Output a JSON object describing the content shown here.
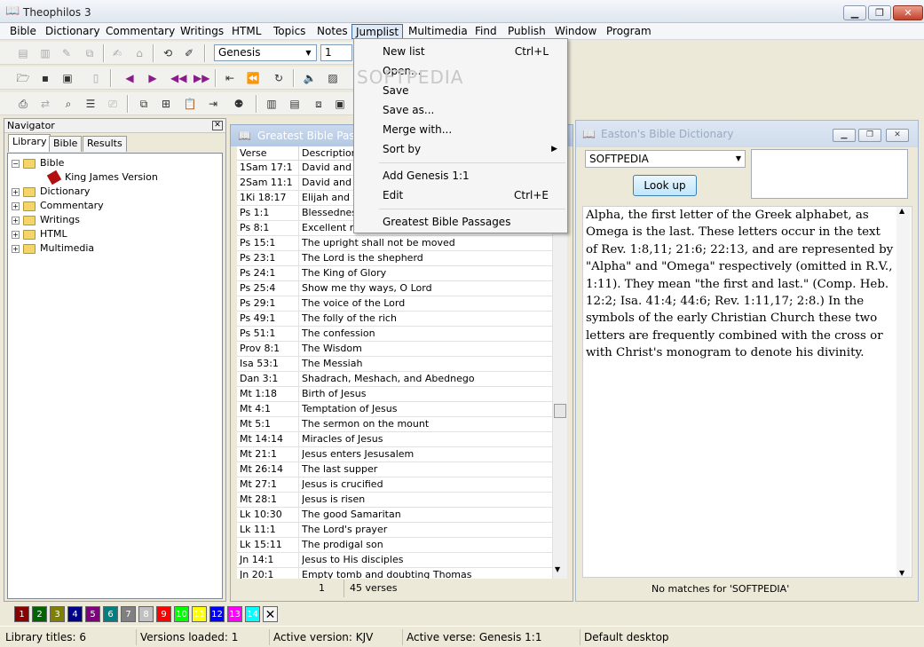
{
  "window": {
    "title": "Theophilos 3"
  },
  "menubar": [
    "Bible",
    "Dictionary",
    "Commentary",
    "Writings",
    "HTML",
    "Topics",
    "Notes",
    "Jumplist",
    "Multimedia",
    "Find",
    "Publish",
    "Window",
    "Program"
  ],
  "toolbar": {
    "book_select": "Genesis",
    "chapter_select": "1"
  },
  "jumplist_menu": {
    "items": [
      {
        "label": "New list",
        "shortcut": "Ctrl+L"
      },
      {
        "label": "Open...",
        "shortcut": ""
      },
      {
        "label": "Save",
        "shortcut": ""
      },
      {
        "label": "Save as...",
        "shortcut": ""
      },
      {
        "label": "Merge with...",
        "shortcut": ""
      },
      {
        "label": "Sort by",
        "shortcut": "▶"
      },
      {
        "label": "Add Genesis 1:1",
        "shortcut": ""
      },
      {
        "label": "Edit",
        "shortcut": "Ctrl+E"
      },
      {
        "label": "Greatest Bible Passages",
        "shortcut": ""
      }
    ]
  },
  "watermark": "SOFTPEDIA",
  "navigator": {
    "title": "Navigator",
    "tabs": [
      "Library",
      "Bible",
      "Results"
    ],
    "tree": [
      {
        "label": "Bible",
        "level": 0,
        "expanded": true
      },
      {
        "label": "King James Version",
        "level": 1
      },
      {
        "label": "Dictionary",
        "level": 0
      },
      {
        "label": "Commentary",
        "level": 0
      },
      {
        "label": "Writings",
        "level": 0
      },
      {
        "label": "HTML",
        "level": 0
      },
      {
        "label": "Multimedia",
        "level": 0
      }
    ]
  },
  "passages": {
    "title": "Greatest Bible Passages",
    "columns": [
      "Verse",
      "Description"
    ],
    "rows": [
      [
        "1Sam 17:1",
        "David and Goliath"
      ],
      [
        "2Sam 11:1",
        "David and Bathsheba"
      ],
      [
        "1Ki 18:17",
        "Elijah and the prophets of Baal"
      ],
      [
        "Ps 1:1",
        "Blessedness"
      ],
      [
        "Ps 8:1",
        "Excellent name"
      ],
      [
        "Ps 15:1",
        "The upright shall not be moved"
      ],
      [
        "Ps 23:1",
        "The Lord is the shepherd"
      ],
      [
        "Ps 24:1",
        "The King of Glory"
      ],
      [
        "Ps 25:4",
        "Show me thy ways, O Lord"
      ],
      [
        "Ps 29:1",
        "The voice of the Lord"
      ],
      [
        "Ps 49:1",
        "The folly of the rich"
      ],
      [
        "Ps 51:1",
        "The confession"
      ],
      [
        "Prov 8:1",
        "The Wisdom"
      ],
      [
        "Isa 53:1",
        "The Messiah"
      ],
      [
        "Dan 3:1",
        "Shadrach, Meshach, and Abednego"
      ],
      [
        "Mt 1:18",
        "Birth of Jesus"
      ],
      [
        "Mt 4:1",
        "Temptation of Jesus"
      ],
      [
        "Mt 5:1",
        "The sermon on the mount"
      ],
      [
        "Mt 14:14",
        "Miracles of Jesus"
      ],
      [
        "Mt 21:1",
        "Jesus enters Jesusalem"
      ],
      [
        "Mt 26:14",
        "The last supper"
      ],
      [
        "Mt 27:1",
        "Jesus is crucified"
      ],
      [
        "Mt 28:1",
        "Jesus is risen"
      ],
      [
        "Lk 10:30",
        "The good Samaritan"
      ],
      [
        "Lk 11:1",
        "The Lord's prayer"
      ],
      [
        "Lk 15:11",
        "The prodigal son"
      ],
      [
        "Jn 14:1",
        "Jesus to His disciples"
      ],
      [
        "Jn 20:1",
        "Empty tomb and doubting Thomas"
      ]
    ],
    "status_page": "1",
    "status_count": "45 verses"
  },
  "dictionary": {
    "title": "Easton's Bible Dictionary",
    "search_value": "SOFTPEDIA",
    "lookup_label": "Look up",
    "text": "Alpha, the first letter of the Greek alphabet, as Omega is the last. These letters occur in the text of Rev. 1:8,11; 21:6; 22:13, and are represented by \"Alpha\" and \"Omega\" respectively (omitted in R.V., 1:11). They mean \"the first and last.\" (Comp. Heb. 12:2; Isa. 41:4; 44:6; Rev. 1:11,17; 2:8.) In the symbols of the early Christian Church these two letters are frequently combined with the cross or with Christ's monogram to denote his divinity.",
    "status": "No matches for 'SOFTPEDIA'"
  },
  "colorbar": [
    {
      "label": "1",
      "color": "#8b0000"
    },
    {
      "label": "2",
      "color": "#006400"
    },
    {
      "label": "3",
      "color": "#808000"
    },
    {
      "label": "4",
      "color": "#00008b"
    },
    {
      "label": "5",
      "color": "#800080"
    },
    {
      "label": "6",
      "color": "#008080"
    },
    {
      "label": "7",
      "color": "#808080"
    },
    {
      "label": "8",
      "color": "#c0c0c0"
    },
    {
      "label": "9",
      "color": "#ff0000"
    },
    {
      "label": "10",
      "color": "#00ff00"
    },
    {
      "label": "11",
      "color": "#ffff00"
    },
    {
      "label": "12",
      "color": "#0000ff"
    },
    {
      "label": "13",
      "color": "#ff00ff"
    },
    {
      "label": "14",
      "color": "#00ffff"
    }
  ],
  "statusbar": {
    "library_titles": "Library titles: 6",
    "versions_loaded": "Versions loaded: 1",
    "active_version": "Active version: KJV",
    "active_verse": "Active verse: Genesis 1:1",
    "desktop": "Default desktop"
  }
}
